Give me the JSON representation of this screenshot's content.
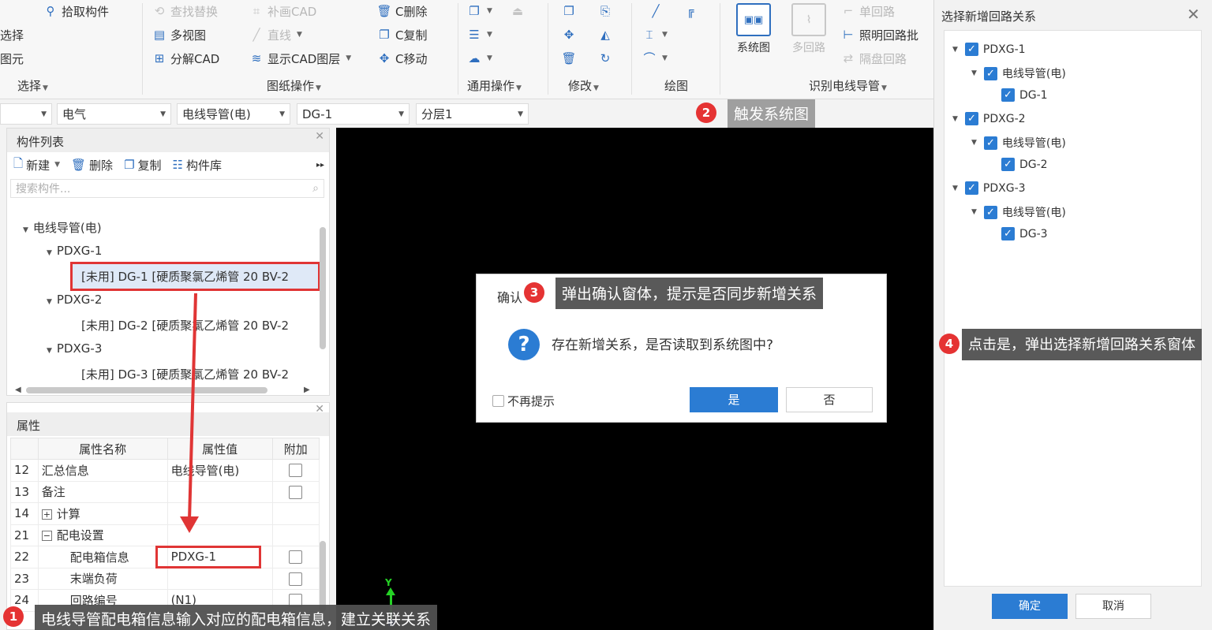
{
  "ribbon": {
    "select_col": [
      "选择",
      "图元"
    ],
    "pick_component": "拾取构件",
    "find_replace": "查找替换",
    "add_cad": "补画CAD",
    "c_delete": "C删除",
    "multi_view": "多视图",
    "line": "直线",
    "c_copy": "C复制",
    "split_cad": "分解CAD",
    "show_cad_layer": "显示CAD图层",
    "c_move": "C移动",
    "system_diagram": "系统图",
    "multi_circuit": "多回路",
    "single_circuit": "单回路",
    "lighting_batch": "照明回路批",
    "cabinet_circuit": "隔盘回路",
    "groups": {
      "select": "选择",
      "drawing_ops": "图纸操作",
      "general_ops": "通用操作",
      "modify": "修改",
      "draw": "绘图",
      "identify_conduit": "识别电线导管"
    }
  },
  "filterbar": {
    "discipline": "电气",
    "type": "电线导管(电)",
    "item": "DG-1",
    "layer": "分层1"
  },
  "component_list": {
    "title": "构件列表",
    "new": "新建",
    "delete": "删除",
    "copy": "复制",
    "library": "构件库",
    "search_placeholder": "搜索构件...",
    "root": "电线导管(电)",
    "groups": [
      {
        "name": "PDXG-1",
        "item": "[未用] DG-1 [硬质聚氯乙烯管 20 BV-2"
      },
      {
        "name": "PDXG-2",
        "item": "[未用] DG-2 [硬质聚氯乙烯管 20 BV-2"
      },
      {
        "name": "PDXG-3",
        "item": "[未用] DG-3 [硬质聚氯乙烯管 20 BV-2"
      }
    ]
  },
  "properties": {
    "title": "属性",
    "headers": {
      "name": "属性名称",
      "value": "属性值",
      "extra": "附加"
    },
    "rows": [
      {
        "no": "12",
        "name": "汇总信息",
        "value": "电线导管(电)"
      },
      {
        "no": "13",
        "name": "备注",
        "value": ""
      },
      {
        "no": "14",
        "name": "计算",
        "value": ""
      },
      {
        "no": "21",
        "name": "配电设置",
        "value": ""
      },
      {
        "no": "22",
        "name": "配电箱信息",
        "value": "PDXG-1"
      },
      {
        "no": "23",
        "name": "末端负荷",
        "value": ""
      },
      {
        "no": "24",
        "name": "回路编号",
        "value": "(N1)"
      }
    ]
  },
  "canvas": {
    "axis_y": "Y"
  },
  "dialog": {
    "title": "确认",
    "message": "存在新增关系，是否读取到系统图中?",
    "no_prompt": "不再提示",
    "yes": "是",
    "no": "否"
  },
  "circuit_panel": {
    "title": "选择新增回路关系",
    "items": [
      {
        "box": "PDXG-1",
        "type": "电线导管(电)",
        "conduit": "DG-1"
      },
      {
        "box": "PDXG-2",
        "type": "电线导管(电)",
        "conduit": "DG-2"
      },
      {
        "box": "PDXG-3",
        "type": "电线导管(电)",
        "conduit": "DG-3"
      }
    ],
    "ok": "确定",
    "cancel": "取消"
  },
  "annotations": {
    "a1": {
      "num": "1",
      "text": "电线导管配电箱信息输入对应的配电箱信息，建立关联关系"
    },
    "a2": {
      "num": "2",
      "text": "触发系统图"
    },
    "a3": {
      "num": "3",
      "text": "弹出确认窗体，提示是否同步新增关系"
    },
    "a4": {
      "num": "4",
      "text": "点击是，弹出选择新增回路关系窗体"
    }
  },
  "colors": {
    "accent": "#2b7cd3",
    "annotation_red": "#e03535",
    "canvas": "#000000"
  }
}
